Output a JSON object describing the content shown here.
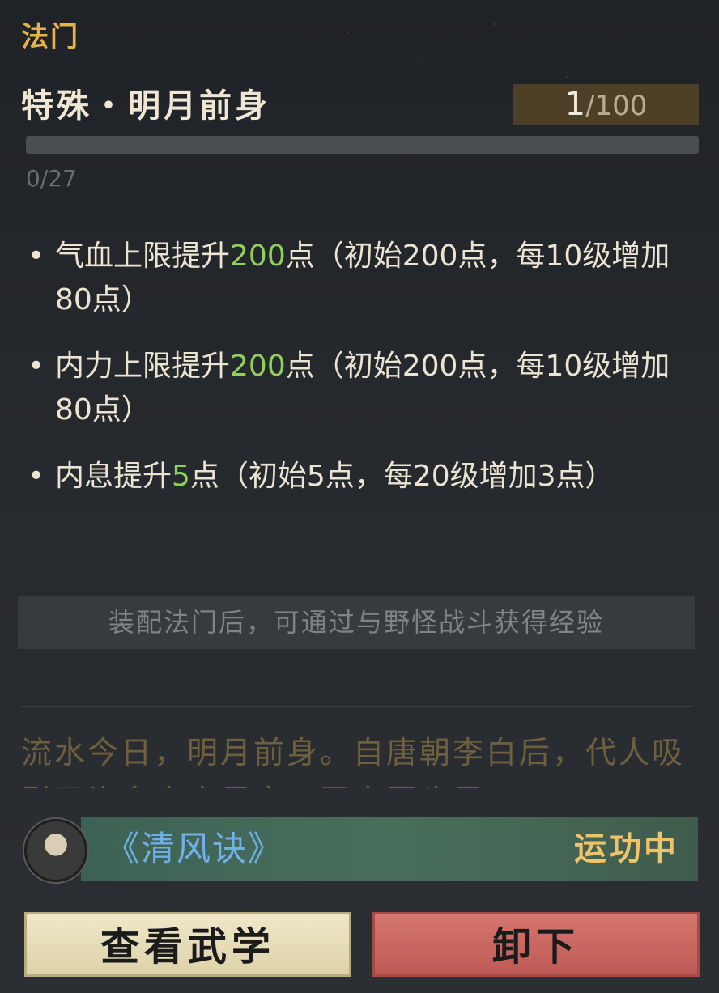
{
  "header": {
    "section": "法门",
    "skill_name": "特殊・明月前身",
    "level_current": "1",
    "level_max": "/100"
  },
  "experience": {
    "text": "0/27",
    "fraction": 0
  },
  "effects": [
    {
      "pre": "气血上限提升",
      "value": "200",
      "post": "点（初始200点，每10级增加80点）"
    },
    {
      "pre": "内力上限提升",
      "value": "200",
      "post": "点（初始200点，每10级增加80点）"
    },
    {
      "pre": "内息提升",
      "value": "5",
      "post": "点（初始5点，每20级增加3点）"
    }
  ],
  "hint": "装配法门后，可通过与野怪战斗获得经验",
  "lore": "流水今日，明月前身。自唐朝李白后，代人吸引了许多文人墨客，司空图也是",
  "equipped": {
    "manual": "《清风诀》",
    "status": "运功中"
  },
  "buttons": {
    "view": "查看武学",
    "unequip": "卸下"
  }
}
